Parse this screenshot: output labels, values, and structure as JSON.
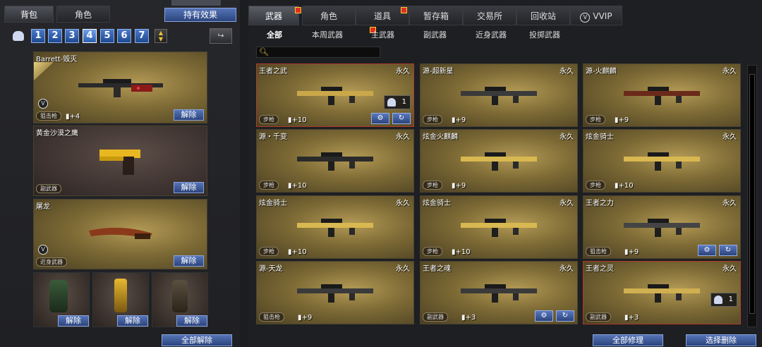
{
  "left_panel": {
    "tabs": [
      "背包",
      "角色"
    ],
    "effect_button": "持有效果",
    "slots": [
      "1",
      "2",
      "3",
      "4",
      "5",
      "6",
      "7"
    ],
    "selected_slot": "4",
    "clear_all": "全部解除"
  },
  "equipped": [
    {
      "name": "Barrett-毁灭",
      "type": "狙击枪",
      "bonus": "+4",
      "unequip": "解除",
      "vvip": true
    },
    {
      "name": "黄金沙漠之鹰",
      "type": "副武器",
      "bonus": "",
      "unequip": "解除",
      "vvip": false
    },
    {
      "name": "屠龙",
      "type": "近身武器",
      "bonus": "",
      "unequip": "解除",
      "vvip": true
    }
  ],
  "grenades": [
    {
      "unequip": "解除"
    },
    {
      "unequip": "解除"
    },
    {
      "unequip": "解除"
    }
  ],
  "right_panel": {
    "tabs": [
      "武器",
      "角色",
      "道具",
      "暂存箱",
      "交易所",
      "回收站",
      "VVIP"
    ],
    "subtabs": [
      "全部",
      "本周武器",
      "主武器",
      "副武器",
      "近身武器",
      "投掷武器"
    ],
    "search_placeholder": "",
    "repair_all": "全部修理",
    "delete_selected": "选择删除"
  },
  "items": [
    {
      "name": "王者之武",
      "perm": "永久",
      "type": "步枪",
      "bonus": "+10",
      "count": "1"
    },
    {
      "name": "源-超新星",
      "perm": "永久",
      "type": "步枪",
      "bonus": "+9"
    },
    {
      "name": "源-火麒麟",
      "perm": "永久",
      "type": "步枪",
      "bonus": "+9"
    },
    {
      "name": "源・千变",
      "perm": "永久",
      "type": "步枪",
      "bonus": "+10"
    },
    {
      "name": "炫金火麒麟",
      "perm": "永久",
      "type": "步枪",
      "bonus": "+9"
    },
    {
      "name": "炫金骑士",
      "perm": "永久",
      "type": "步枪",
      "bonus": "+10"
    },
    {
      "name": "炫金骑士",
      "perm": "永久",
      "type": "步枪",
      "bonus": "+10"
    },
    {
      "name": "炫金骑士",
      "perm": "永久",
      "type": "步枪",
      "bonus": "+10"
    },
    {
      "name": "王者之力",
      "perm": "永久",
      "type": "狙击枪",
      "bonus": "+9"
    },
    {
      "name": "源-天龙",
      "perm": "永久",
      "type": "狙击枪",
      "bonus": "+9"
    },
    {
      "name": "王者之魂",
      "perm": "永久",
      "type": "副武器",
      "bonus": "+3"
    },
    {
      "name": "王者之灵",
      "perm": "永久",
      "type": "副武器",
      "bonus": "+3",
      "count": "1"
    }
  ]
}
